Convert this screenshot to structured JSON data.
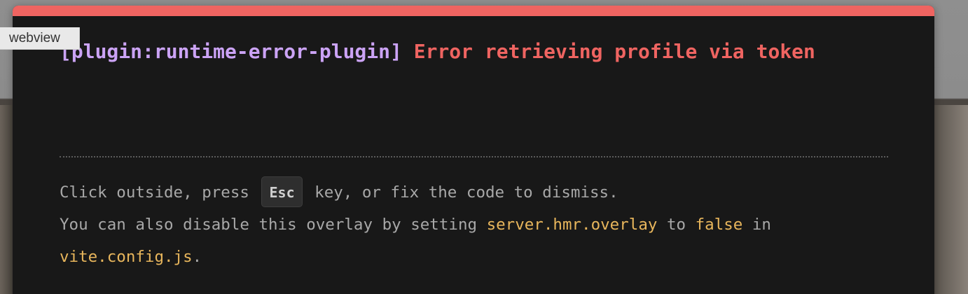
{
  "webview_label": "webview",
  "error": {
    "plugin": "[plugin:runtime-error-plugin]",
    "message": "Error retrieving profile via token"
  },
  "tip": {
    "line1_before": "Click outside, press ",
    "key": "Esc",
    "line1_after": " key, or fix the code to dismiss.",
    "line2_before": "You can also disable this overlay by setting ",
    "setting": "server.hmr.overlay",
    "line2_middle": " to ",
    "value": "false",
    "line2_after": " in",
    "config_file": "vite.config.js",
    "line3_after": "."
  },
  "colors": {
    "accent_bar": "#ef6461",
    "plugin_text": "#cba3f5",
    "error_text": "#ef6461",
    "code_text": "#e8b65c",
    "overlay_bg": "#181818"
  }
}
